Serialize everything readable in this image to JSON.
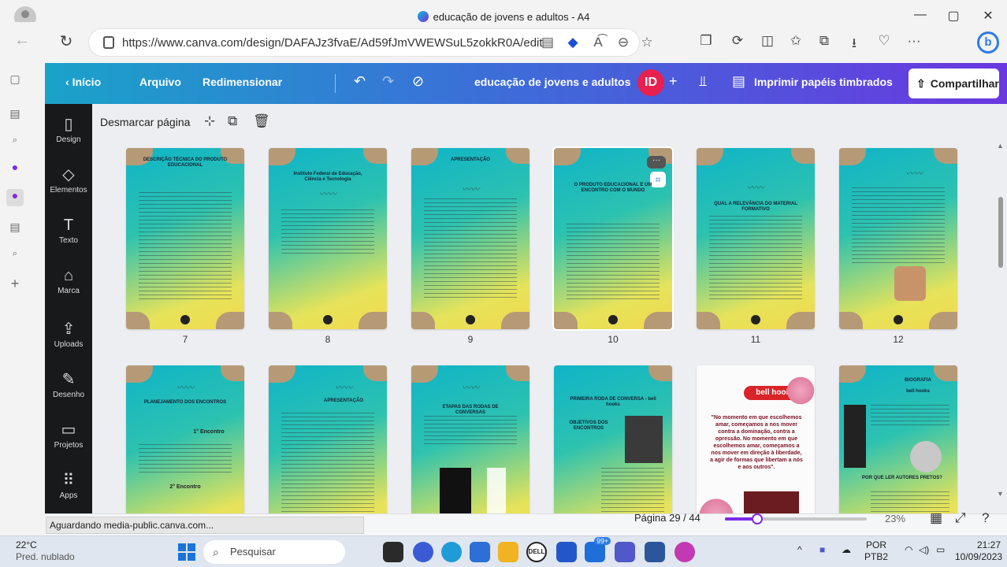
{
  "browser": {
    "tab_title": "educação de jovens e adultos - A4",
    "url": "https://www.canva.com/design/DAFAJz3fvaE/Ad59fJmVWEWSuL5zokkR0A/edit",
    "url_tools": [
      "clipboard-icon",
      "extension-icon",
      "read-aloud-icon",
      "zoom-icon",
      "favorite-icon"
    ],
    "read_aloud_label": "A͡",
    "bar_tools": [
      "extensions-icon",
      "sync-icon",
      "split-screen-icon",
      "favorites-icon",
      "collections-icon",
      "downloads-icon",
      "health-icon",
      "more-icon"
    ],
    "more_label": "···"
  },
  "canva_top": {
    "back_label": "Início",
    "file_label": "Arquivo",
    "resize_label": "Redimensionar",
    "design_title": "educação de jovens e adultos",
    "avatar_initials": "ID",
    "print_label": "Imprimir papéis timbrados",
    "share_label": "Compartilhar"
  },
  "canva_side": {
    "tools": [
      {
        "label": "Design",
        "icon": "▯"
      },
      {
        "label": "Elementos",
        "icon": "◇"
      },
      {
        "label": "Texto",
        "icon": "T"
      },
      {
        "label": "Marca",
        "icon": "⌂"
      },
      {
        "label": "Uploads",
        "icon": "⇪"
      },
      {
        "label": "Desenho",
        "icon": "✎"
      },
      {
        "label": "Projetos",
        "icon": "▭"
      },
      {
        "label": "Apps",
        "icon": "⠿"
      }
    ]
  },
  "workspace": {
    "deselect_label": "Desmarcar página",
    "row1": [
      {
        "number": "7",
        "heading": "DESCRIÇÃO TÉCNICA DO PRODUTO EDUCACIONAL"
      },
      {
        "number": "8",
        "heading": "Instituto Federal de Educação, Ciência e Tecnologia"
      },
      {
        "number": "9",
        "heading": "APRESENTAÇÃO"
      },
      {
        "number": "10",
        "heading": "O PRODUTO EDUCACIONAL E UM ENCONTRO COM O MUNDO"
      },
      {
        "number": "11",
        "heading": "QUAL A RELEVÂNCIA DO MATERIAL FORMATIVO"
      },
      {
        "number": "12",
        "heading": ""
      }
    ],
    "row2": [
      {
        "heading": "PLANEJAMENTO DOS ENCONTROS"
      },
      {
        "heading": "APRESENTAÇÃO"
      },
      {
        "heading": "ETAPAS DAS RODAS DE CONVERSAS"
      },
      {
        "heading": "PRIMEIRA RODA DE CONVERSA - bell hooks"
      },
      {
        "heading": "bell hooks"
      },
      {
        "heading": "BIOGRAFIA"
      }
    ],
    "row2_texts": {
      "objectives": "OBJETIVOS DOS ENCONTROS",
      "bell_quote": "\"No momento em que escolhemos amar, começamos a nos mover contra a dominação, contra a opressão. No momento em que escolhemos amar, começamos a nos mover em direção à liberdade, a agir de formas que libertam a nós e aos outros\".",
      "why_authors": "POR QUE LER AUTORES PRETOS?",
      "encounter_1": "1° Encontro",
      "encounter_2": "2° Encontro",
      "biography_name": "bell hooks"
    }
  },
  "footer": {
    "status_text": "Aguardando media-public.canva.com...",
    "page_info": "Página 29 / 44",
    "zoom": "23%",
    "zoom_level": 0.23,
    "help_label": "?"
  },
  "taskbar": {
    "temperature": "22°C",
    "weather_desc": "Pred. nublado",
    "search_placeholder": "Pesquisar",
    "lang_top": "POR",
    "lang_bottom": "PTB2",
    "time": "21:27",
    "date": "10/09/2023",
    "notif_count": "99+"
  },
  "colors": {
    "canva_gradient_start": "#1aa3c9",
    "canva_gradient_end": "#6a37e0",
    "avatar": "#e9204f",
    "page_teal": "#0fb4c7",
    "page_yellow": "#f2d94e"
  }
}
